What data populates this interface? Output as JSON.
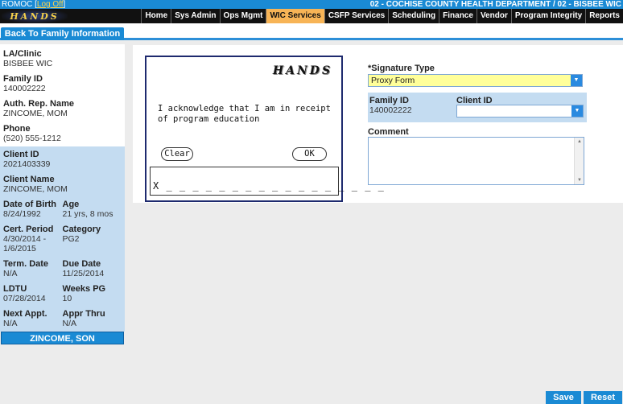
{
  "topbar": {
    "user": "ROMOC",
    "logoff_prefix": "[",
    "logoff": "Log Off",
    "logoff_suffix": "]",
    "department": "02 - COCHISE COUNTY HEALTH DEPARTMENT / 02 - BISBEE WIC"
  },
  "logo_text": "HANDS",
  "nav": {
    "tabs": [
      "Home",
      "Sys Admin",
      "Ops Mgmt",
      "WIC Services",
      "CSFP Services",
      "Scheduling",
      "Finance",
      "Vendor",
      "Program Integrity",
      "Reports"
    ],
    "active_index": 3
  },
  "back_button": "Back To Family Information",
  "sidebar": {
    "la_clinic": {
      "label": "LA/Clinic",
      "value": "BISBEE WIC"
    },
    "family_id": {
      "label": "Family ID",
      "value": "140002222"
    },
    "auth_rep": {
      "label": "Auth. Rep. Name",
      "value": "ZINCOME, MOM"
    },
    "phone": {
      "label": "Phone",
      "value": "(520) 555-1212"
    },
    "client_id": {
      "label": "Client ID",
      "value": "2021403339"
    },
    "client_name": {
      "label": "Client Name",
      "value": "ZINCOME, MOM"
    },
    "dob": {
      "label": "Date of Birth",
      "value": "8/24/1992"
    },
    "age": {
      "label": "Age",
      "value": "21 yrs, 8 mos"
    },
    "cert_period": {
      "label": "Cert. Period",
      "value": "4/30/2014 -",
      "value2": "1/6/2015"
    },
    "category": {
      "label": "Category",
      "value": "PG2"
    },
    "term_date": {
      "label": "Term. Date",
      "value": "N/A"
    },
    "due_date": {
      "label": "Due Date",
      "value": "11/25/2014"
    },
    "ldtu": {
      "label": "LDTU",
      "value": "07/28/2014"
    },
    "weeks_pg": {
      "label": "Weeks PG",
      "value": "10"
    },
    "next_appt": {
      "label": "Next Appt.",
      "value": "N/A"
    },
    "appr_thru": {
      "label": "Appr Thru",
      "value": "N/A"
    },
    "other_client": "ZINCOME, SON"
  },
  "signature_pad": {
    "logo": "HANDS",
    "acknowledgement": "I acknowledge that I am in receipt of program education",
    "clear": "Clear",
    "ok": "OK",
    "line": "X _ _ _ _ _ _ _ _ _ _ _ _ _ _ _ _ _"
  },
  "form": {
    "signature_type_label": "*Signature Type",
    "signature_type_value": "Proxy Form",
    "family_id_label": "Family ID",
    "family_id_value": "140002222",
    "client_id_label": "Client ID",
    "client_id_value": "",
    "comment_label": "Comment",
    "comment_value": ""
  },
  "buttons": {
    "save": "Save",
    "reset": "Reset"
  },
  "colors": {
    "accent": "#1a8ad4",
    "active_tab": "#f7b456",
    "highlight_field": "#ffff99",
    "sidebar_panel": "#c4dcf1"
  },
  "icons": {
    "dropdown": "chevron-down-icon",
    "scroll_up": "scroll-up-icon",
    "scroll_down": "scroll-down-icon"
  }
}
